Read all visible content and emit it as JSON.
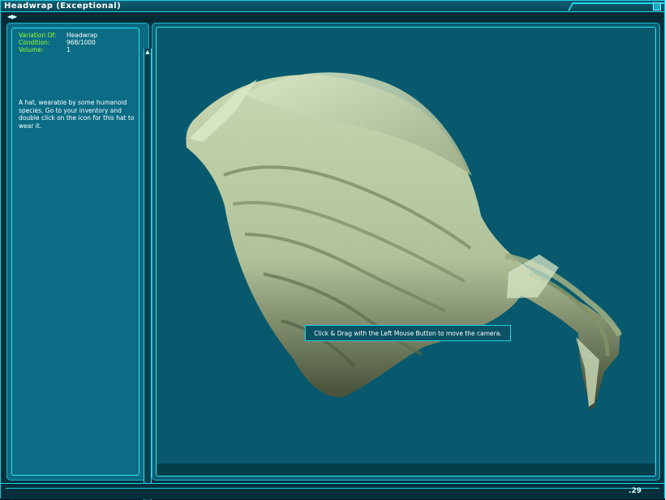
{
  "window": {
    "title": "Headwrap (Exceptional)",
    "nav": "◂◆▸",
    "corner": ".29"
  },
  "attributes": [
    {
      "label": "Variation Of:",
      "value": "Headwrap"
    },
    {
      "label": "Condition:",
      "value": "968/1000"
    },
    {
      "label": "Volume:",
      "value": "1"
    }
  ],
  "description": "A hat, wearable by some humanoid species. Go to your inventory and double click on the icon for this hat to wear it.",
  "viewer": {
    "tooltip": "Click & Drag with the Left Mouse Button to move the camera."
  },
  "colors": {
    "frame": "#1fc8de",
    "attribute_label": "#9aff2e",
    "panel": "#0b6d85",
    "viewport": "#08596d"
  },
  "icons": [
    "close-icon",
    "scroll-up-icon",
    "scroll-down-icon"
  ]
}
